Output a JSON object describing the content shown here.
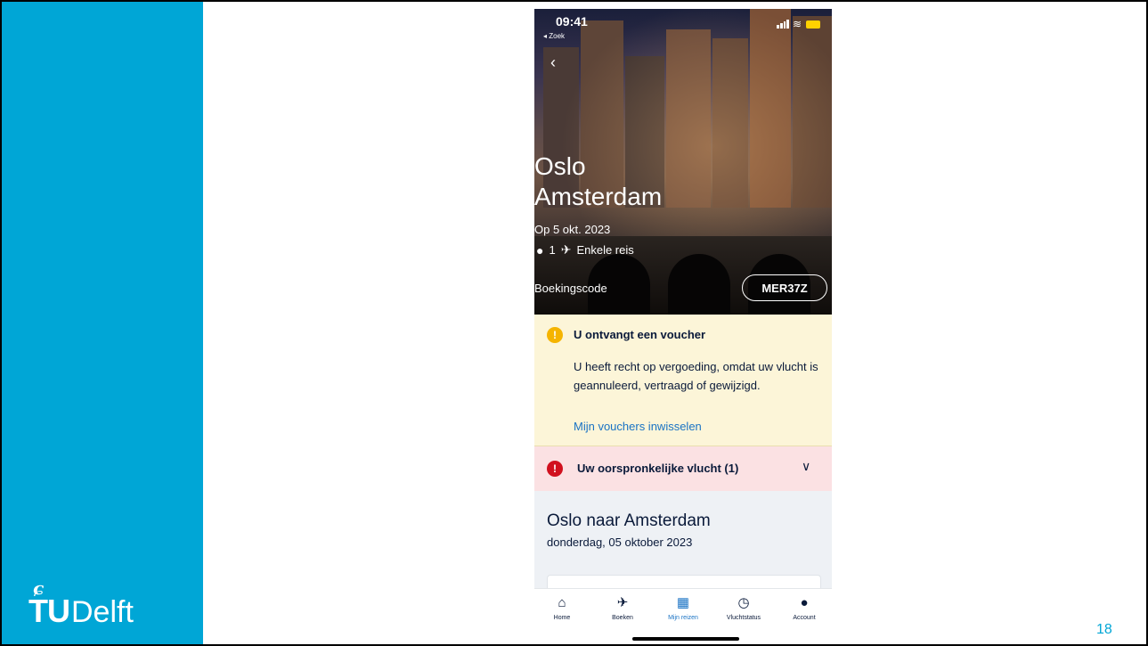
{
  "slide": {
    "logo_tu": "TU",
    "logo_delft": "Delft",
    "page_number": "18",
    "accent_color": "#00A6D6"
  },
  "phone": {
    "status_bar": {
      "time": "09:41",
      "back_app": "◂ Zoek"
    },
    "header": {
      "origin": "Oslo",
      "destination": "Amsterdam",
      "date": "Op 5 okt. 2023",
      "passengers": "1",
      "trip_type": "Enkele reis",
      "booking_label": "Boekingscode",
      "booking_code": "MER37Z"
    },
    "voucher_notice": {
      "title": "U ontvangt een voucher",
      "body": "U heeft recht op vergoeding, omdat uw vlucht is geannuleerd, vertraagd of gewijzigd.",
      "link": "Mijn vouchers inwisselen"
    },
    "original_flight": {
      "label": "Uw oorspronkelijke vlucht (1)"
    },
    "trip": {
      "title": "Oslo naar Amsterdam",
      "date": "donderdag, 05 oktober 2023"
    },
    "tabbar": [
      {
        "label": "Home",
        "icon": "home-icon"
      },
      {
        "label": "Boeken",
        "icon": "plane-icon"
      },
      {
        "label": "Mijn reizen",
        "icon": "calendar-icon"
      },
      {
        "label": "Vluchtstatus",
        "icon": "clock-icon"
      },
      {
        "label": "Account",
        "icon": "account-icon"
      }
    ]
  }
}
